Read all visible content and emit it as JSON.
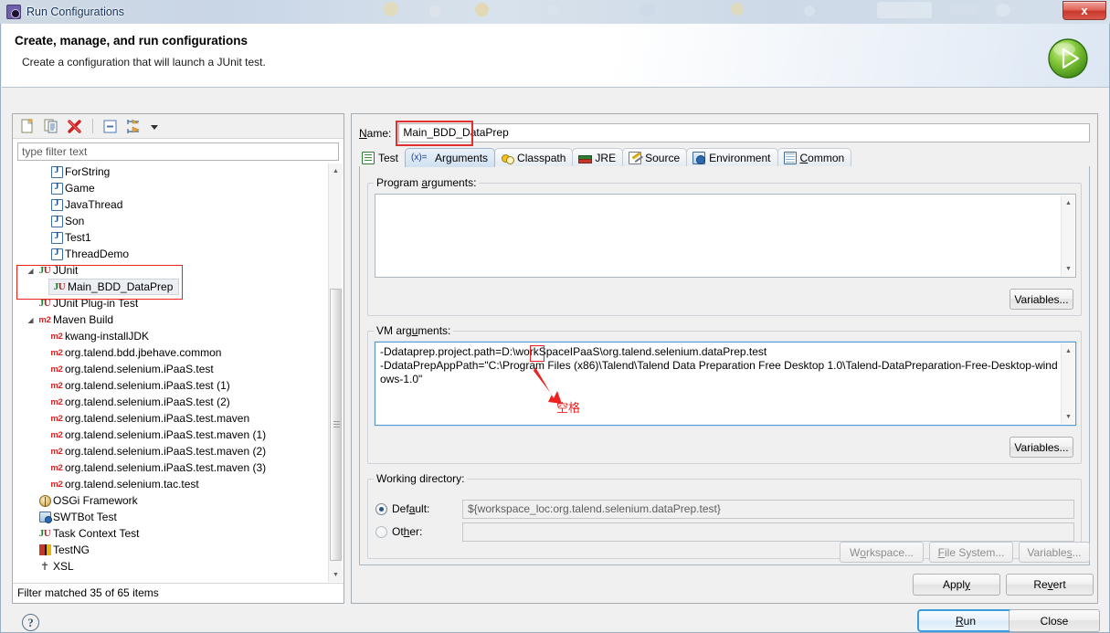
{
  "window": {
    "title": "Run Configurations",
    "app_icon": "gear-icon",
    "close_label": "x"
  },
  "header": {
    "title": "Create, manage, and run configurations",
    "subtitle": "Create a configuration that will launch a JUnit test.",
    "badge_icon": "run-play-icon"
  },
  "tree_toolbar": {
    "items": [
      {
        "name": "new-launch-configuration",
        "icon": "new-document-icon"
      },
      {
        "name": "duplicate-launch-configuration",
        "icon": "copy-icon"
      },
      {
        "name": "delete-launch-configuration",
        "icon": "red-x-icon"
      },
      {
        "name": "collapse-all",
        "icon": "collapse-all-icon"
      },
      {
        "name": "filter-launch-configurations",
        "icon": "filter-icon"
      },
      {
        "name": "view-menu",
        "icon": "chevron-down-icon"
      }
    ]
  },
  "filter": {
    "placeholder": "type filter text",
    "value": "",
    "status": "Filter matched 35 of 65 items"
  },
  "tree": {
    "items": [
      {
        "label": "ForString",
        "icon": "java-class-icon",
        "level": 2,
        "expander": ""
      },
      {
        "label": "Game",
        "icon": "java-class-icon",
        "level": 2,
        "expander": ""
      },
      {
        "label": "JavaThread",
        "icon": "java-class-icon",
        "level": 2,
        "expander": ""
      },
      {
        "label": "Son",
        "icon": "java-class-icon",
        "level": 2,
        "expander": ""
      },
      {
        "label": "Test1",
        "icon": "java-class-icon",
        "level": 2,
        "expander": ""
      },
      {
        "label": "ThreadDemo",
        "icon": "java-class-icon",
        "level": 2,
        "expander": ""
      },
      {
        "label": "JUnit",
        "icon": "junit-icon",
        "level": 1,
        "expander": "expanded"
      },
      {
        "label": "Main_BDD_DataPrep",
        "icon": "junit-icon",
        "level": 2,
        "expander": "",
        "selected": true
      },
      {
        "label": "JUnit Plug-in Test",
        "icon": "junit-plugin-icon",
        "level": 1,
        "expander": ""
      },
      {
        "label": "Maven Build",
        "icon": "maven-icon",
        "level": 1,
        "expander": "expanded"
      },
      {
        "label": "kwang-installJDK",
        "icon": "maven-icon",
        "level": 2,
        "expander": ""
      },
      {
        "label": "org.talend.bdd.jbehave.common",
        "icon": "maven-icon",
        "level": 2,
        "expander": ""
      },
      {
        "label": "org.talend.selenium.iPaaS.test",
        "icon": "maven-icon",
        "level": 2,
        "expander": ""
      },
      {
        "label": "org.talend.selenium.iPaaS.test (1)",
        "icon": "maven-icon",
        "level": 2,
        "expander": ""
      },
      {
        "label": "org.talend.selenium.iPaaS.test (2)",
        "icon": "maven-icon",
        "level": 2,
        "expander": ""
      },
      {
        "label": "org.talend.selenium.iPaaS.test.maven",
        "icon": "maven-icon",
        "level": 2,
        "expander": ""
      },
      {
        "label": "org.talend.selenium.iPaaS.test.maven (1)",
        "icon": "maven-icon",
        "level": 2,
        "expander": ""
      },
      {
        "label": "org.talend.selenium.iPaaS.test.maven (2)",
        "icon": "maven-icon",
        "level": 2,
        "expander": ""
      },
      {
        "label": "org.talend.selenium.iPaaS.test.maven (3)",
        "icon": "maven-icon",
        "level": 2,
        "expander": ""
      },
      {
        "label": "org.talend.selenium.tac.test",
        "icon": "maven-icon",
        "level": 2,
        "expander": ""
      },
      {
        "label": "OSGi Framework",
        "icon": "osgi-icon",
        "level": 1,
        "expander": ""
      },
      {
        "label": "SWTBot Test",
        "icon": "swtbot-icon",
        "level": 1,
        "expander": ""
      },
      {
        "label": "Task Context Test",
        "icon": "junit-icon",
        "level": 1,
        "expander": ""
      },
      {
        "label": "TestNG",
        "icon": "testng-icon",
        "level": 1,
        "expander": ""
      },
      {
        "label": "XSL",
        "icon": "xsl-icon",
        "level": 1,
        "expander": ""
      }
    ]
  },
  "config": {
    "name_label": "Name:",
    "name_value": "Main_BDD_DataPrep"
  },
  "tabs": [
    {
      "label": "Test",
      "icon": "test-icon",
      "active": false
    },
    {
      "label": "Arguments",
      "icon": "arguments-icon",
      "active": true
    },
    {
      "label": "Classpath",
      "icon": "classpath-icon",
      "active": false
    },
    {
      "label": "JRE",
      "icon": "jre-icon",
      "active": false
    },
    {
      "label": "Source",
      "icon": "source-icon",
      "active": false
    },
    {
      "label": "Environment",
      "icon": "environment-icon",
      "active": false
    },
    {
      "label": "Common",
      "icon": "common-icon",
      "active": false
    }
  ],
  "arguments": {
    "program_label": "Program arguments:",
    "program_value": "",
    "program_variables_label": "Variables...",
    "vm_label": "VM arguments:",
    "vm_value": "-Ddataprep.project.path=D:\\workSpaceIPaaS\\org.talend.selenium.dataPrep.test\n-DdataPrepAppPath=\"C:\\Program Files (x86)\\Talend\\Talend Data Preparation Free Desktop 1.0\\Talend-DataPreparation-Free-Desktop-windows-1.0\"",
    "vm_variables_label": "Variables..."
  },
  "working_directory": {
    "group_label": "Working directory:",
    "default_label": "Default:",
    "default_selected": true,
    "default_value": "${workspace_loc:org.talend.selenium.dataPrep.test}",
    "other_label": "Other:",
    "other_selected": false,
    "other_value": "",
    "workspace_label": "Workspace...",
    "filesystem_label": "File System...",
    "variables_label": "Variables..."
  },
  "actions": {
    "apply_label": "Apply",
    "revert_label": "Revert",
    "run_label": "Run",
    "close_label": "Close",
    "help_icon": "help-question-icon"
  },
  "annotations": {
    "space_note": "空格",
    "accent_color": "#ef2020"
  }
}
